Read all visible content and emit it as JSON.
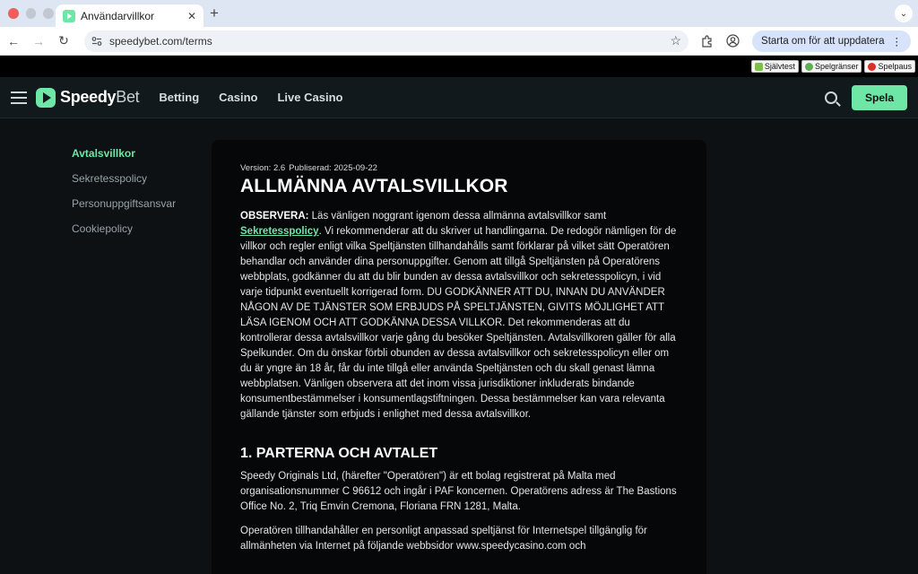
{
  "browser": {
    "tab_title": "Användarvillkor",
    "url": "speedybet.com/terms",
    "update_label": "Starta om för att uppdatera"
  },
  "topstrip": {
    "items": [
      "Självtest",
      "Spelgränser",
      "Spelpaus"
    ]
  },
  "header": {
    "logo_bold": "Speedy",
    "logo_light": "Bet",
    "nav": [
      "Betting",
      "Casino",
      "Live Casino"
    ],
    "play_label": "Spela"
  },
  "sidebar": {
    "items": [
      {
        "label": "Avtalsvillkor",
        "active": true
      },
      {
        "label": "Sekretesspolicy",
        "active": false
      },
      {
        "label": "Personuppgiftsansvar",
        "active": false
      },
      {
        "label": "Cookiepolicy",
        "active": false
      }
    ]
  },
  "doc": {
    "version": "Version: 2.6",
    "published": "Publiserad: 2025-09-22",
    "title": "ALLMÄNNA AVTALSVILLKOR",
    "intro_label": "OBSERVERA:",
    "intro_a": " Läs vänligen noggrant igenom dessa allmänna avtalsvillkor samt ",
    "intro_link": "Sekretesspolicy",
    "intro_b": ". Vi rekommenderar att du skriver ut handlingarna. De redogör nämligen för de villkor och regler enligt vilka Speltjänsten tillhandahålls samt förklarar på vilket sätt Operatören behandlar och använder dina personuppgifter. Genom att tillgå Speltjänsten på Operatörens webbplats, godkänner du att du blir bunden av dessa avtalsvillkor och sekretesspolicyn, i vid varje tidpunkt eventuellt korrigerad form. DU GODKÄNNER ATT DU, INNAN DU ANVÄNDER NÅGON AV DE TJÄNSTER SOM ERBJUDS PÅ SPELTJÄNSTEN, GIVITS MÖJLIGHET ATT LÄSA IGENOM OCH ATT GODKÄNNA DESSA VILLKOR. Det rekommenderas att du kontrollerar dessa avtalsvillkor varje gång du besöker Speltjänsten. Avtalsvillkoren gäller för alla Spelkunder. Om du önskar förbli obunden av dessa avtalsvillkor och sekretesspolicyn eller om du är yngre än 18 år, får du inte tillgå eller använda Speltjänsten och du skall genast lämna webbplatsen. Vänligen observera att det inom vissa jurisdiktioner inkluderats bindande konsumentbestämmelser i konsumentlagstiftningen. Dessa bestämmelser kan vara relevanta gällande tjänster som erbjuds i enlighet med dessa avtalsvillkor.",
    "section1_title": "1. PARTERNA OCH AVTALET",
    "section1_p1": "Speedy Originals Ltd, (härefter \"Operatören\") är ett bolag registrerat på Malta med organisationsnummer C 96612 och ingår i PAF koncernen. Operatörens adress är The Bastions Office No. 2, Triq Emvin Cremona, Floriana FRN 1281, Malta.",
    "section1_p2": "Operatören tillhandahåller en personligt anpassad speltjänst för Internetspel tillgänglig för allmänheten via Internet på följande webbsidor www.speedycasino.com och"
  }
}
